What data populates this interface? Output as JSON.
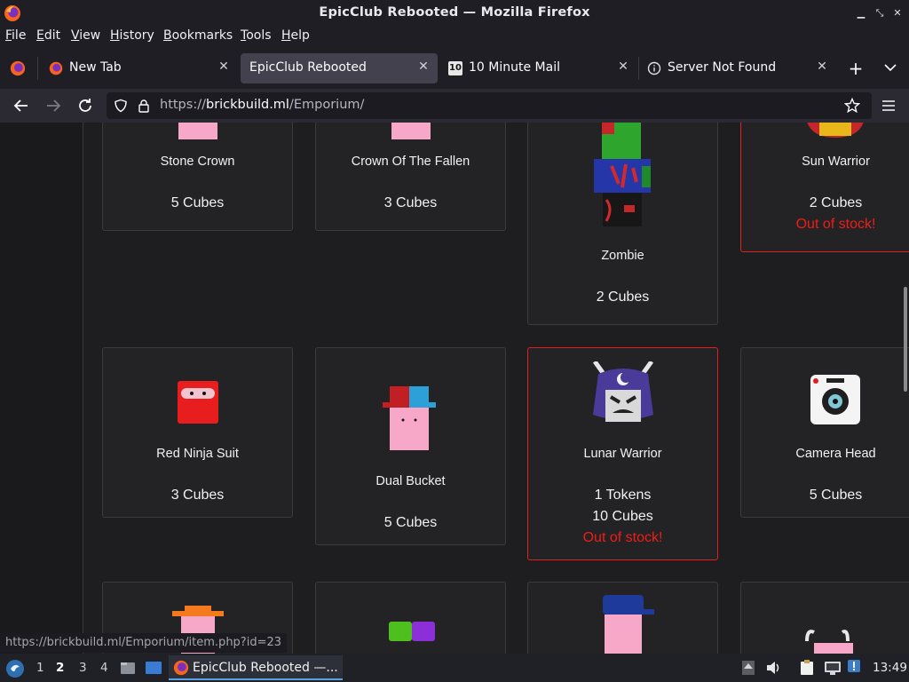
{
  "window": {
    "title": "EpicClub Rebooted — Mozilla Firefox"
  },
  "menu": [
    "File",
    "Edit",
    "View",
    "History",
    "Bookmarks",
    "Tools",
    "Help"
  ],
  "tabs": [
    {
      "label": "New Tab",
      "active": false
    },
    {
      "label": "EpicClub Rebooted",
      "active": true
    },
    {
      "label": "10 Minute Mail",
      "active": false,
      "favicon_text": "10"
    },
    {
      "label": "Server Not Found",
      "active": false
    }
  ],
  "navigation": {
    "url_prefix": "https://",
    "url_domain": "brickbuild.ml",
    "url_path": "/Emporium/"
  },
  "items": [
    {
      "name": "Stone Crown",
      "price": "5 Cubes"
    },
    {
      "name": "Crown Of The Fallen",
      "price": "3 Cubes"
    },
    {
      "name": "Zombie",
      "price": "2 Cubes"
    },
    {
      "name": "Sun Warrior",
      "price": "2 Cubes",
      "stock": "Out of stock!"
    },
    {
      "name": "Red Ninja Suit",
      "price": "3 Cubes"
    },
    {
      "name": "Dual Bucket",
      "price": "5 Cubes"
    },
    {
      "name": "Lunar Warrior",
      "price_tokens": "1 Tokens",
      "price": "10 Cubes",
      "stock": "Out of stock!"
    },
    {
      "name": "Camera Head",
      "price": "5 Cubes"
    }
  ],
  "status_url": "https://brickbuild.ml/Emporium/item.php?id=23",
  "taskbar": {
    "workspaces": [
      "1",
      "2",
      "3",
      "4"
    ],
    "active_workspace": "2",
    "task_label": "EpicClub Rebooted —...",
    "clock": "13:49"
  },
  "colors": {
    "out_of_stock": "#ef1d17",
    "page_bg": "#1e1e20",
    "card_border": "#3b3b3f"
  }
}
